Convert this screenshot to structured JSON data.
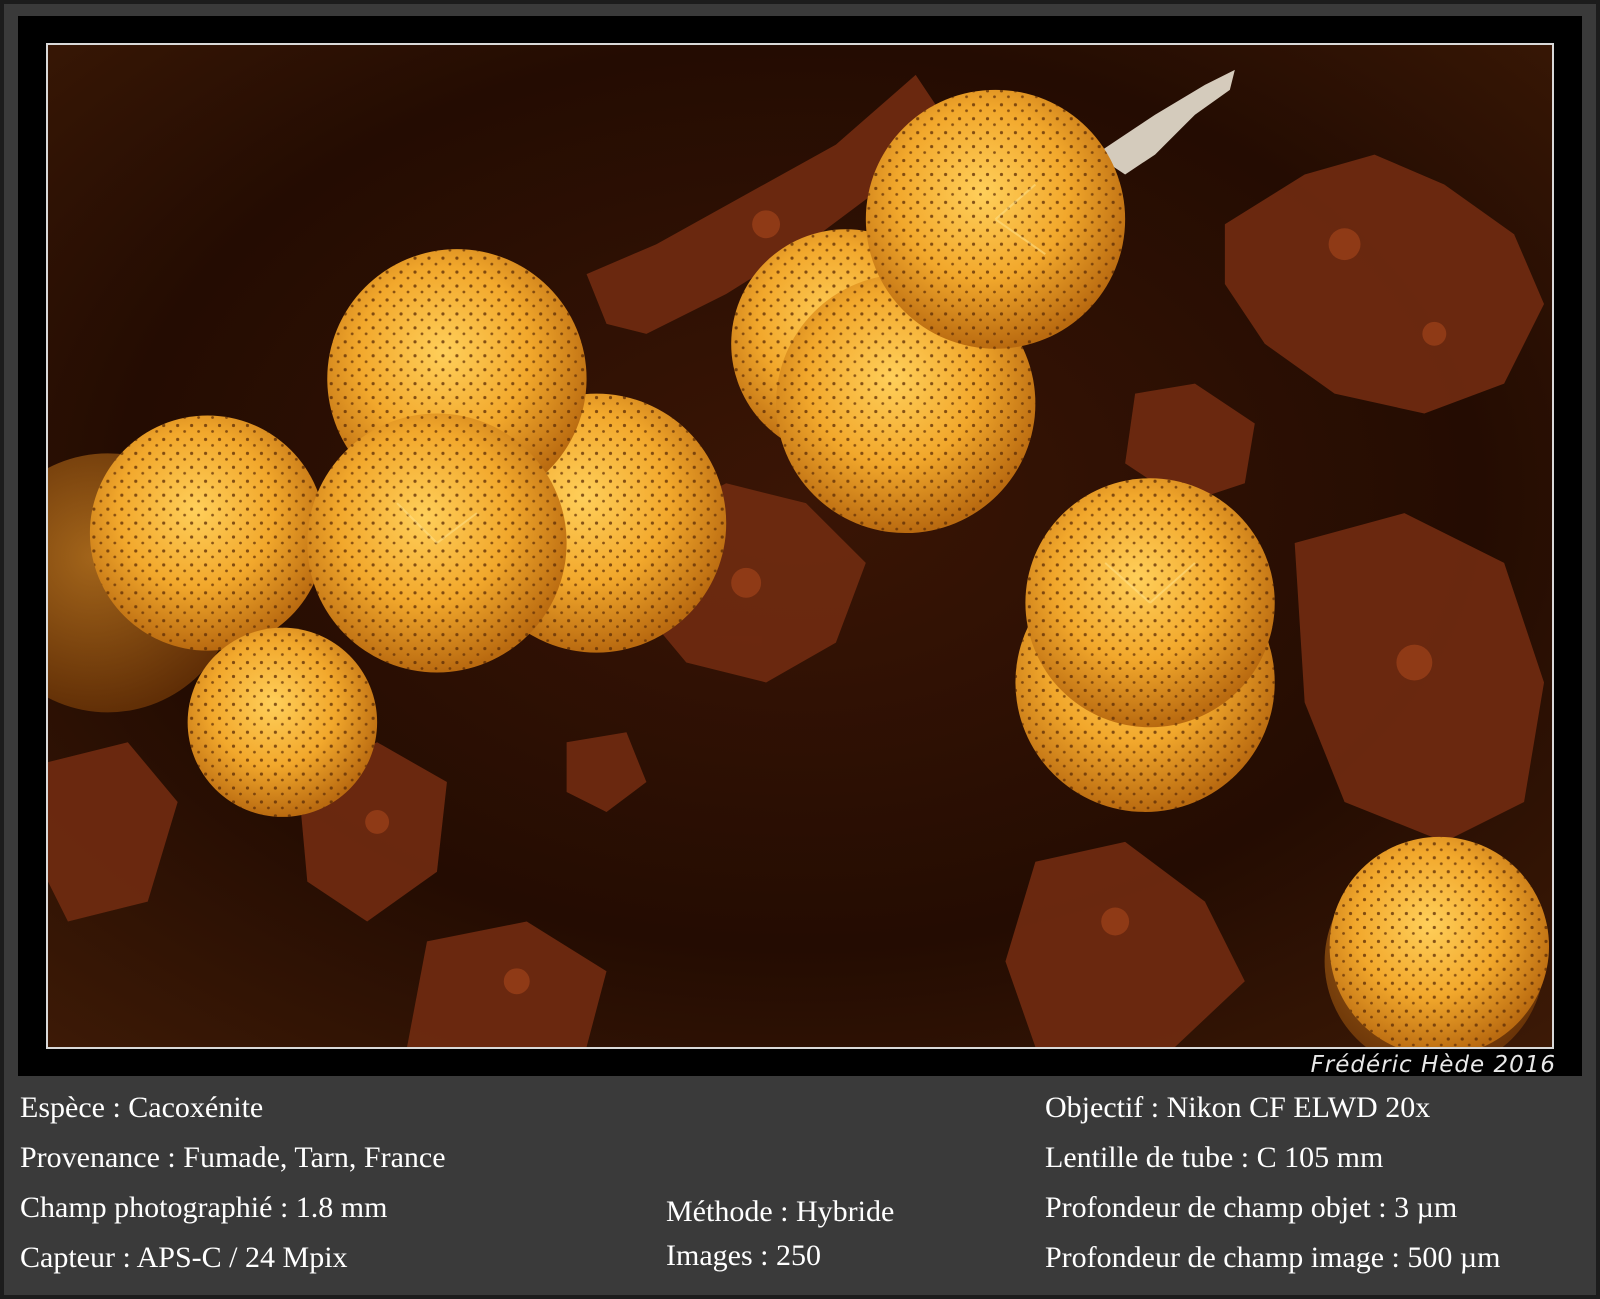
{
  "signature": "Frédéric Hède 2016",
  "left_column": [
    "Espèce : Cacoxénite",
    "Provenance : Fumade, Tarn, France",
    "Champ photographié : 1.8 mm",
    "Capteur : APS-C / 24 Mpix"
  ],
  "middle_column": [
    "Méthode : Hybride",
    "Images : 250"
  ],
  "right_column": [
    "Objectif : Nikon CF ELWD 20x",
    "Lentille de tube : C 105 mm",
    "Profondeur de champ objet : 3 µm",
    "Profondeur de champ image : 500 µm"
  ],
  "colors": {
    "background": "#2f2f2f",
    "photo_border": "#d9d9d9",
    "sphere": "#f0a830",
    "matrix": "#6e2a10"
  }
}
